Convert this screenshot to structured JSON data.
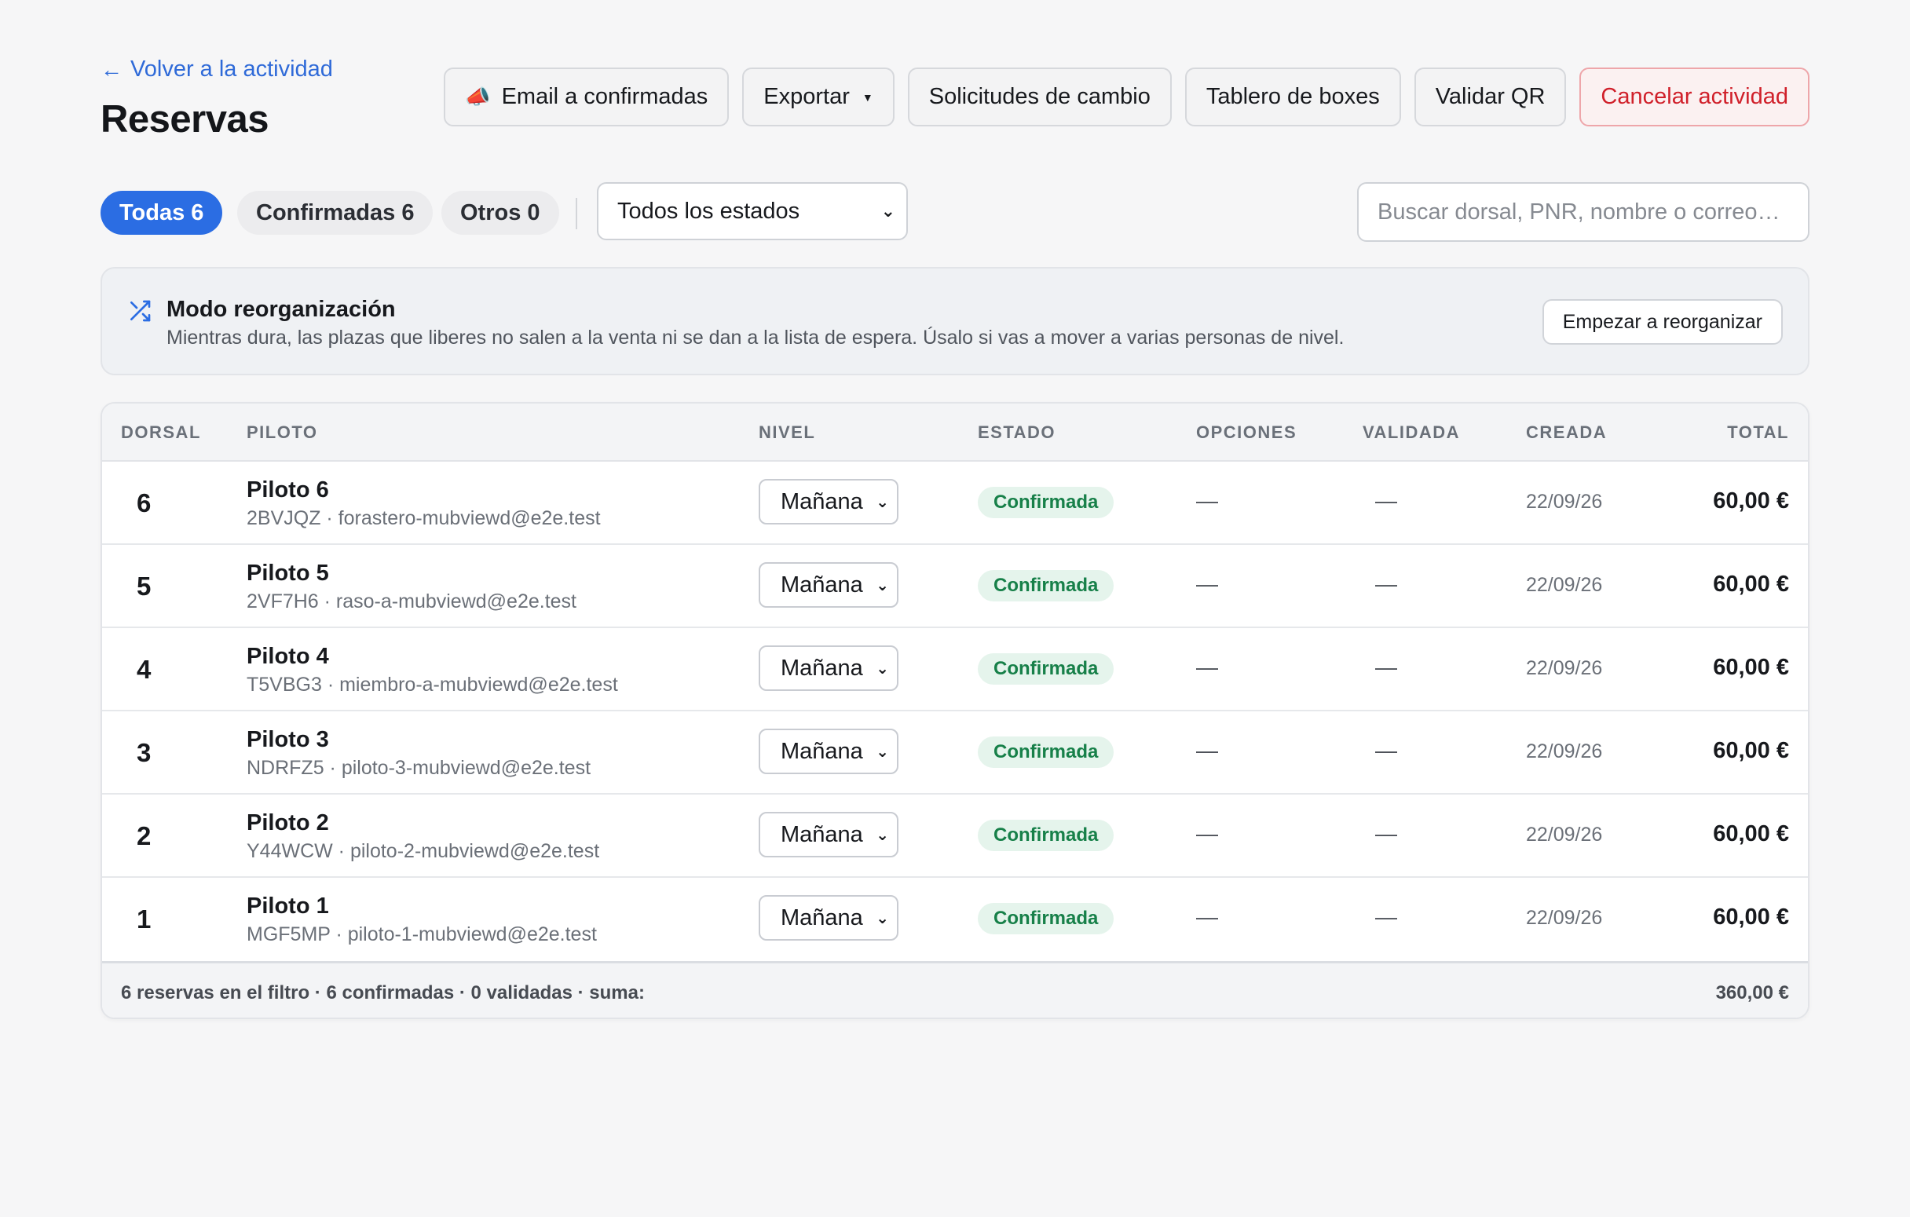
{
  "header": {
    "back_label": "Volver a la actividad",
    "title": "Reservas"
  },
  "toolbar": {
    "email_label": "Email a confirmadas",
    "export_label": "Exportar",
    "change_requests_label": "Solicitudes de cambio",
    "boxes_board_label": "Tablero de boxes",
    "validate_qr_label": "Validar QR",
    "cancel_label": "Cancelar actividad"
  },
  "filters": {
    "tab_all": "Todas 6",
    "tab_confirmed": "Confirmadas 6",
    "tab_others": "Otros 0",
    "state_select_value": "Todos los estados",
    "search_placeholder": "Buscar dorsal, PNR, nombre o correo…"
  },
  "banner": {
    "title": "Modo reorganización",
    "text": "Mientras dura, las plazas que liberes no salen a la venta ni se dan a la lista de espera. Úsalo si vas a mover a varias personas de nivel.",
    "button": "Empezar a reorganizar"
  },
  "table": {
    "headers": {
      "dorsal": "DORSAL",
      "piloto": "PILOTO",
      "nivel": "NIVEL",
      "estado": "ESTADO",
      "opciones": "OPCIONES",
      "validada": "VALIDADA",
      "creada": "CREADA",
      "total": "TOTAL"
    },
    "rows": [
      {
        "dorsal": "6",
        "name": "Piloto 6",
        "sub": "2BVJQZ · forastero-mubviewd@e2e.test",
        "level": "Mañana",
        "status": "Confirmada",
        "options": "—",
        "validated": "—",
        "created": "22/09/26",
        "total": "60,00 €"
      },
      {
        "dorsal": "5",
        "name": "Piloto 5",
        "sub": "2VF7H6 · raso-a-mubviewd@e2e.test",
        "level": "Mañana",
        "status": "Confirmada",
        "options": "—",
        "validated": "—",
        "created": "22/09/26",
        "total": "60,00 €"
      },
      {
        "dorsal": "4",
        "name": "Piloto 4",
        "sub": "T5VBG3 · miembro-a-mubviewd@e2e.test",
        "level": "Mañana",
        "status": "Confirmada",
        "options": "—",
        "validated": "—",
        "created": "22/09/26",
        "total": "60,00 €"
      },
      {
        "dorsal": "3",
        "name": "Piloto 3",
        "sub": "NDRFZ5 · piloto-3-mubviewd@e2e.test",
        "level": "Mañana",
        "status": "Confirmada",
        "options": "—",
        "validated": "—",
        "created": "22/09/26",
        "total": "60,00 €"
      },
      {
        "dorsal": "2",
        "name": "Piloto 2",
        "sub": "Y44WCW · piloto-2-mubviewd@e2e.test",
        "level": "Mañana",
        "status": "Confirmada",
        "options": "—",
        "validated": "—",
        "created": "22/09/26",
        "total": "60,00 €"
      },
      {
        "dorsal": "1",
        "name": "Piloto 1",
        "sub": "MGF5MP · piloto-1-mubviewd@e2e.test",
        "level": "Mañana",
        "status": "Confirmada",
        "options": "—",
        "validated": "—",
        "created": "22/09/26",
        "total": "60,00 €"
      }
    ],
    "footer": {
      "summary": "6 reservas en el filtro · 6 confirmadas · 0 validadas · suma:",
      "sum": "360,00 €"
    }
  },
  "colors": {
    "accent": "#2b6de3",
    "danger": "#d0202a",
    "confirmed_bg": "#e5f4ec",
    "confirmed_text": "#178049"
  },
  "icons": {
    "back": "arrow-left-icon",
    "email": "megaphone-icon",
    "export_caret": "caret-down-icon",
    "reorg": "shuffle-icon",
    "select": "chevron-down-icon"
  }
}
